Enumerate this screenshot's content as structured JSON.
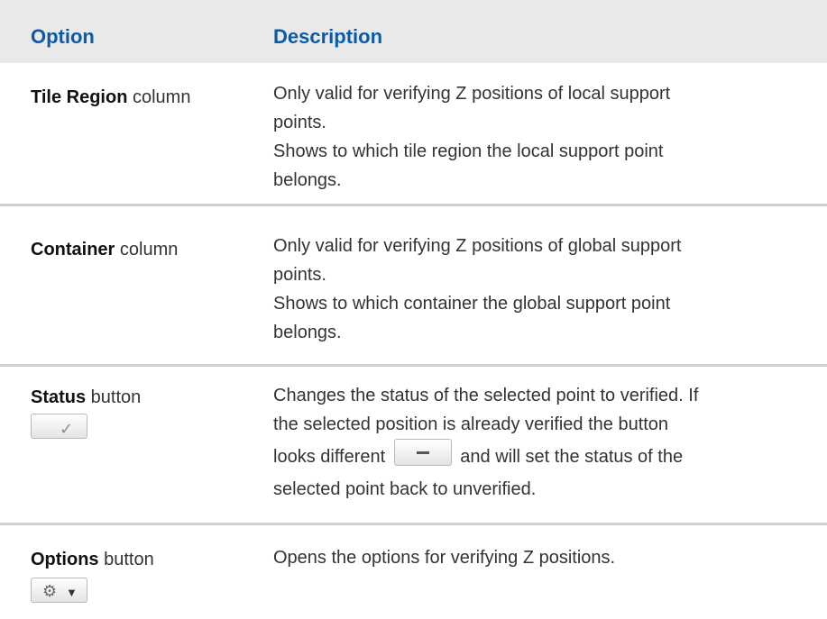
{
  "table": {
    "headers": {
      "option": "Option",
      "description": "Description"
    },
    "rows": [
      {
        "option_bold": "Tile Region",
        "option_rest": " column",
        "description": [
          "Only valid for verifying Z positions of local support",
          "points.",
          "Shows to which tile region the local support point",
          "belongs."
        ]
      },
      {
        "option_bold": "Container",
        "option_rest": " column",
        "description": [
          "Only valid for verifying Z positions of global support",
          "points.",
          "Shows to which container the global support point",
          "belongs."
        ]
      },
      {
        "option_bold": "Status",
        "option_rest": " button",
        "option_icon": "check-icon",
        "description": [
          "Changes the status of the selected point to verified. If",
          "the selected position is already verified the button",
          "looks different",
          "and will set the status of the",
          "selected point back to unverified."
        ],
        "inline_icon": "dash-icon"
      },
      {
        "option_bold": "Options",
        "option_rest": " button",
        "option_icon": "gear-icon",
        "description": [
          "Opens the options for verifying Z positions."
        ]
      }
    ]
  },
  "colors": {
    "header_bg": "#e9e9e9",
    "header_text": "#0b5aa8",
    "divider": "#cfcfcf"
  }
}
